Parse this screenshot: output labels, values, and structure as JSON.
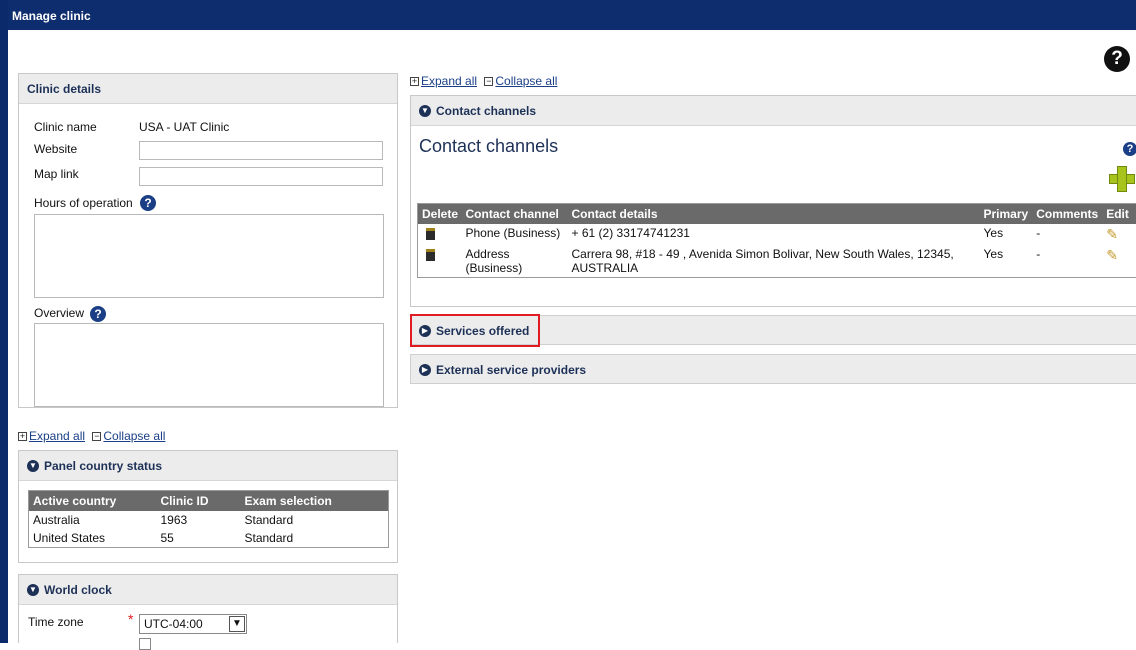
{
  "window": {
    "title": "Manage clinic"
  },
  "help_glyph": "?",
  "clinic_details": {
    "title": "Clinic details",
    "clinic_name_label": "Clinic name",
    "clinic_name_value": "USA - UAT Clinic",
    "website_label": "Website",
    "website_value": "",
    "map_link_label": "Map link",
    "map_link_value": "",
    "hours_label": "Hours of operation",
    "hours_value": "",
    "overview_label": "Overview",
    "overview_value": ""
  },
  "left_links": {
    "expand_all": "Expand all",
    "collapse_all": "Collapse all"
  },
  "right_links": {
    "expand_all": "Expand all",
    "collapse_all": "Collapse all"
  },
  "panel_country_status": {
    "title": "Panel country status",
    "columns": [
      "Active country",
      "Clinic ID",
      "Exam selection"
    ],
    "rows": [
      [
        "Australia",
        "1963",
        "Standard"
      ],
      [
        "United States",
        "55",
        "Standard"
      ]
    ]
  },
  "world_clock": {
    "title": "World clock",
    "time_zone_label": "Time zone",
    "time_zone_value": "UTC-04:00",
    "required_mark": "*"
  },
  "contact_channels": {
    "section_title": "Contact channels",
    "heading": "Contact channels",
    "columns": [
      "Delete",
      "Contact channel",
      "Contact details",
      "Primary",
      "Comments",
      "Edit"
    ],
    "rows": [
      {
        "channel": "Phone (Business)",
        "details": "+ 61 (2) 33174741231",
        "primary": "Yes",
        "comments": "-"
      },
      {
        "channel": "Address (Business)",
        "details": "Carrera 98, #18 - 49 , Avenida Simon Bolivar, New South Wales, 12345, AUSTRALIA",
        "primary": "Yes",
        "comments": "-"
      }
    ]
  },
  "services_offered": {
    "title": "Services offered"
  },
  "external_service_providers": {
    "title": "External service providers"
  },
  "icons": {
    "help": "question-circle-icon",
    "chevron": "chevron-circle-icon",
    "expand": "plus-square-icon",
    "collapse": "minus-square-icon",
    "delete": "trash-icon",
    "edit": "pencil-icon",
    "add": "green-plus-icon"
  },
  "colors": {
    "title_bar": "#0d2d6e",
    "panel_header": "#ececec",
    "table_header": "#6a6a6a",
    "highlight": "#e01b24",
    "add_icon": "#a8c31b"
  }
}
